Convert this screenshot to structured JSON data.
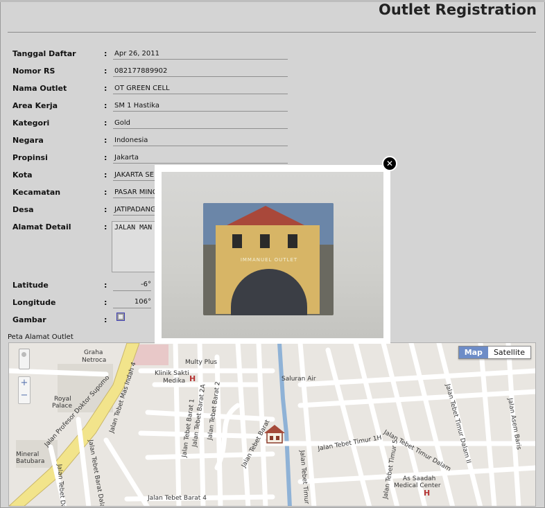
{
  "header": {
    "title": "Outlet Registration"
  },
  "form": {
    "fields": [
      {
        "label": "Tanggal Daftar",
        "value": "Apr 26, 2011"
      },
      {
        "label": "Nomor RS",
        "value": "082177889902"
      },
      {
        "label": "Nama Outlet",
        "value": "OT GREEN CELL"
      },
      {
        "label": "Area Kerja",
        "value": "SM 1 Hastika"
      },
      {
        "label": "Kategori",
        "value": "Gold"
      },
      {
        "label": "Negara",
        "value": "Indonesia"
      },
      {
        "label": "Propinsi",
        "value": "Jakarta"
      },
      {
        "label": "Kota",
        "value": "JAKARTA SE"
      },
      {
        "label": "Kecamatan",
        "value": "PASAR MING"
      },
      {
        "label": "Desa",
        "value": "JATIPADANG"
      }
    ],
    "alamat": {
      "label": "Alamat Detail",
      "value": "JALAN MAN"
    },
    "latitude": {
      "label": "Latitude",
      "value": "-6°"
    },
    "longitude": {
      "label": "Longitude",
      "value": "106°"
    },
    "gambar": {
      "label": "Gambar",
      "icon": "image-icon"
    },
    "colon": ":"
  },
  "map": {
    "label": "Peta Alamat Outlet",
    "type_buttons": {
      "map": "Map",
      "satellite": "Satellite",
      "selected": "Map"
    },
    "zoom": {
      "in": "+",
      "out": "−"
    },
    "places": [
      "Graha Netroca",
      "Multy Plus",
      "Klinik Sakti Medika",
      "Saluran Air",
      "Royal Palace",
      "Jalan Profesor Doktor Supomo",
      "Jalan Tebet Mas Indah 4",
      "Jalan Tebet Barat 1",
      "Jalan Tebet Barat 2A",
      "Jalan Tebet Barat 2",
      "Jalan Tebet Barat",
      "Jalan Tebet Barat 4",
      "Jalan Tebet Timur 1H",
      "Jalan Tebet Timur Dalam",
      "Jalan Asem Baris",
      "As Saadah Medical Center",
      "Mineral Batubara",
      "Jalan Tebet Timur",
      "Jalan Tebet Dalam 1",
      "Jalan Tebet Barat Dalam",
      "Jalan Tebet Timur Dalam II",
      "Jalan Tebet Timur 5"
    ],
    "hospital_mark": "H"
  },
  "popup": {
    "close_symbol": "✕",
    "photo_sign": "IMMANUEL OUTLET"
  }
}
